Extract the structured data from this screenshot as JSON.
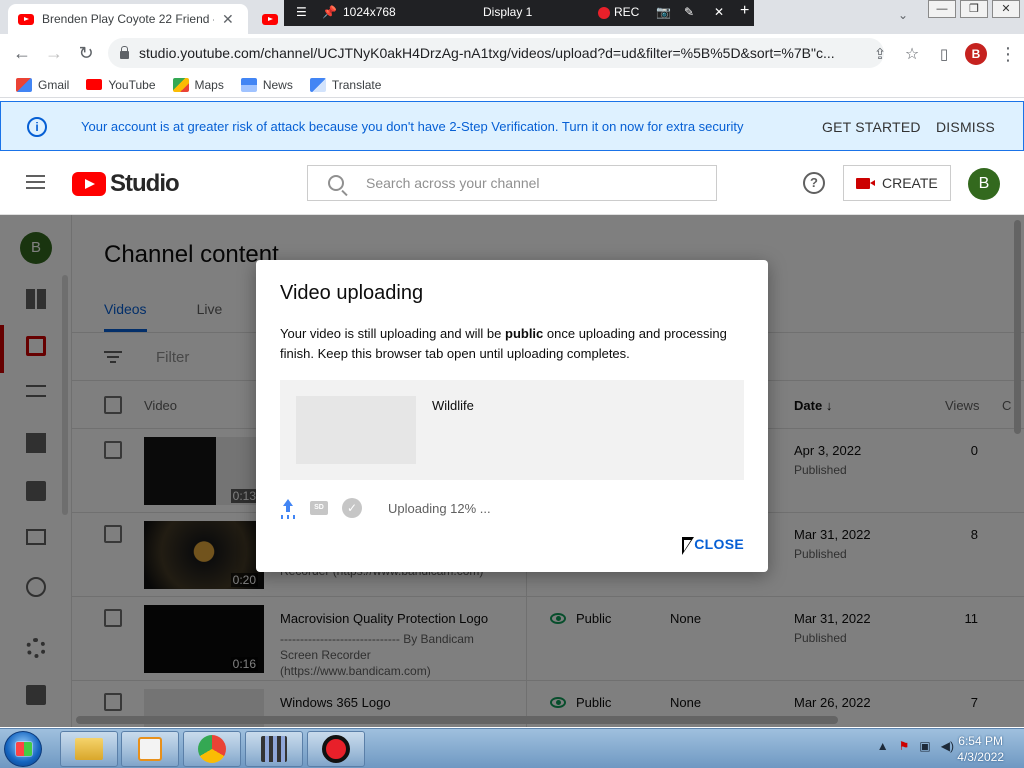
{
  "browser": {
    "tab_title": "Brenden Play Coyote 22 Friend -",
    "url": "studio.youtube.com/channel/UCJTNyK0akH4DrzAg-nA1txg/videos/upload?d=ud&filter=%5B%5D&sort=%7B\"c...",
    "profile_initial": "B",
    "bookmarks": [
      "Gmail",
      "YouTube",
      "Maps",
      "News",
      "Translate"
    ]
  },
  "recorder": {
    "resolution": "1024x768",
    "display": "Display 1",
    "rec_label": "REC"
  },
  "banner": {
    "message": "Your account is at greater risk of attack because you don't have 2-Step Verification. Turn it on now for extra security",
    "get_started": "GET STARTED",
    "dismiss": "DISMISS"
  },
  "header": {
    "logo_word": "Studio",
    "search_placeholder": "Search across your channel",
    "create_label": "CREATE",
    "avatar_initial": "B"
  },
  "main": {
    "title": "Channel content",
    "tabs": [
      "Videos",
      "Live"
    ],
    "filter_placeholder": "Filter",
    "columns": {
      "video": "Video",
      "date": "Date",
      "views": "Views",
      "comments": "C"
    },
    "rows": [
      {
        "duration": "0:13",
        "title": "",
        "desc": "",
        "visibility": "",
        "restrictions": "",
        "date": "Apr 3, 2022",
        "status": "Published",
        "views": "0"
      },
      {
        "duration": "0:20",
        "title": "",
        "desc": "Recorder (https://www.bandicam.com)",
        "visibility": "",
        "restrictions": "",
        "date": "Mar 31, 2022",
        "status": "Published",
        "views": "8"
      },
      {
        "duration": "0:16",
        "title": "Macrovision Quality Protection Logo",
        "desc": "------------------------------ By Bandicam Screen Recorder (https://www.bandicam.com)",
        "visibility": "Public",
        "restrictions": "None",
        "date": "Mar 31, 2022",
        "status": "Published",
        "views": "11"
      },
      {
        "duration": "",
        "title": "Windows 365 Logo",
        "desc": "",
        "visibility": "Public",
        "restrictions": "None",
        "date": "Mar 26, 2022",
        "status": "",
        "views": "7"
      }
    ]
  },
  "dialog": {
    "title": "Video uploading",
    "body_before": "Your video is still uploading and will be ",
    "body_bold": "public",
    "body_after": " once uploading and processing finish. Keep this browser tab open until uploading completes.",
    "file_name": "Wildlife",
    "progress_percent": 12,
    "status_text": "Uploading 12% ...",
    "close_label": "CLOSE"
  },
  "taskbar": {
    "time": "6:54 PM",
    "date": "4/3/2022"
  },
  "colors": {
    "accent": "#065fd4",
    "youtube_red": "#ff0000",
    "banner_bg": "#def1ff"
  }
}
